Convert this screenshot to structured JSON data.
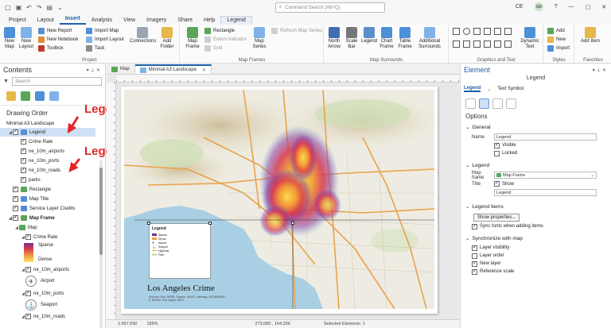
{
  "titlebar": {
    "search_placeholder": "Command Search (Alt+Q)",
    "user_initials": "CE",
    "avatar_initials": "SM"
  },
  "ribbon_tabs": [
    "Project",
    "Layout",
    "Insert",
    "Analysis",
    "View",
    "Imagery",
    "Share",
    "Help",
    "Legend"
  ],
  "active_tab": "Insert",
  "ribbon": {
    "project_group": "Project",
    "new_map": "New Map",
    "new_layout": "New Layout",
    "new_report": "New Report",
    "new_notebook": "New Notebook",
    "toolbox": "Toolbox",
    "import_map": "Import Map",
    "import_layout": "Import Layout",
    "task": "Task",
    "connections": "Connections",
    "add_folder": "Add Folder",
    "map_frames_group": "Map Frames",
    "map_frame": "Map Frame",
    "rectangle": "Rectangle",
    "extent_indicator": "Extent Indicator",
    "grid": "Grid",
    "map_series": "Map Series",
    "refresh_map_series": "Refresh Map Series",
    "map_surrounds_group": "Map Surrounds",
    "north_arrow": "North Arrow",
    "scale_bar": "Scale Bar",
    "legend": "Legend",
    "chart_frame": "Chart Frame",
    "table_frame": "Table Frame",
    "additional_surrounds": "Additional Surrounds",
    "graphics_group": "Graphics and Text",
    "dynamic_text": "Dynamic Text",
    "styles_group": "Styles",
    "add": "Add",
    "new": "New",
    "import": "Import",
    "favorites_group": "Favorites",
    "add_item": "Add Item"
  },
  "contents": {
    "title": "Contents",
    "search_placeholder": "Search",
    "drawing_order": "Drawing Order",
    "items": [
      {
        "label": "Minimal A3 Landscape"
      },
      {
        "label": "Legend"
      },
      {
        "label": "Crime Rate"
      },
      {
        "label": "ne_10m_airports"
      },
      {
        "label": "ne_10m_ports"
      },
      {
        "label": "ne_10m_roads"
      },
      {
        "label": "parks"
      },
      {
        "label": "Rectangle"
      },
      {
        "label": "Map Title"
      },
      {
        "label": "Service Layer Credits"
      },
      {
        "label": "Map Frame"
      },
      {
        "label": "Map"
      },
      {
        "label": "Crime Rate"
      },
      {
        "label": "Sparse"
      },
      {
        "label": "Dense"
      },
      {
        "label": "ne_10m_airports"
      },
      {
        "label": "Airport"
      },
      {
        "label": "ne_10m_ports"
      },
      {
        "label": "Seaport"
      },
      {
        "label": "ne_10m_roads"
      }
    ]
  },
  "annotations": {
    "legend_level": "Legend Level",
    "legend_item_level": "Legend Item Level"
  },
  "view_tabs": [
    {
      "label": "Map"
    },
    {
      "label": "Minimal A3 Landscape"
    }
  ],
  "layout": {
    "legend_title": "Legend",
    "legend_items": [
      "Sparse",
      "Dense",
      "Airport",
      "Seaport",
      "Highway",
      "Park"
    ],
    "map_title": "Los Angeles Crime",
    "credits": "Sources: Esri, HERE, Garmin, USGS, Intermap, INCREMENT P, NRCan, Esri Japan, METI"
  },
  "statusbar": {
    "scale": "1:657,690",
    "zoom": "185%",
    "coords": "273,080 , 164,206",
    "selected": "Selected Elements: 1"
  },
  "element": {
    "title": "Element",
    "subtitle": "Legend",
    "tabs": [
      "Legend",
      "Text Symbol"
    ],
    "options": "Options",
    "general": "General",
    "name_label": "Name",
    "name_value": "Legend",
    "visible": "Visible",
    "locked": "Locked",
    "legend_section": "Legend",
    "map_frame_label": "Map frame",
    "map_frame_value": "Map Frame",
    "title_label": "Title",
    "show": "Show",
    "title_value": "Legend",
    "legend_items_section": "Legend Items",
    "show_properties": "Show properties...",
    "sync_fonts": "Sync fonts when adding items",
    "synchronize": "Synchronize with map",
    "layer_visibility": "Layer visibility",
    "layer_order": "Layer order",
    "new_layer": "New layer",
    "reference_scale": "Reference scale"
  },
  "colors": {
    "accent": "#1f5fa8",
    "annotation": "#e42525",
    "selection": "#cfe0f5"
  }
}
